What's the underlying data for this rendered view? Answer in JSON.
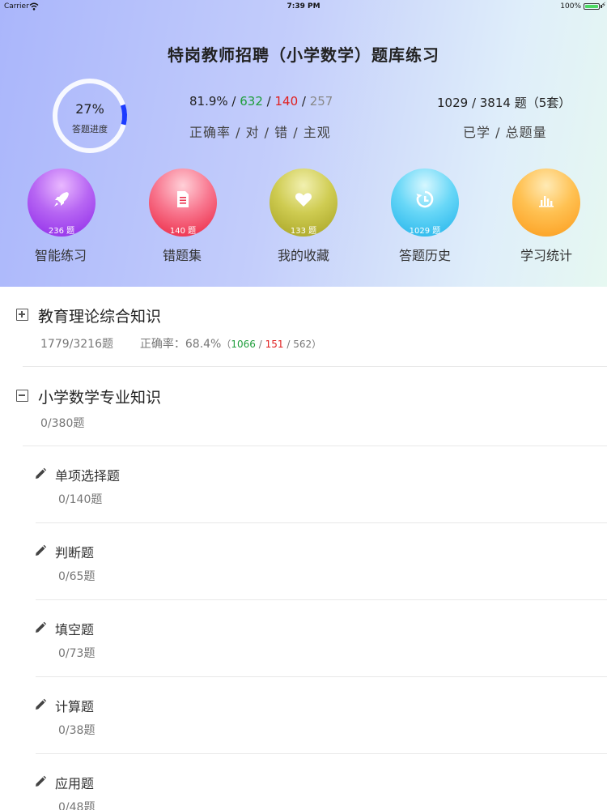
{
  "statusbar": {
    "carrier": "Carrier",
    "time": "7:39 PM",
    "battery": "100%"
  },
  "title": "特岗教师招聘（小学数学）题库练习",
  "progress": {
    "percent_text": "27%",
    "label": "答题进度",
    "value": 0.27
  },
  "stats": {
    "accuracy": "81.9%",
    "correct": "632",
    "wrong": "140",
    "subjective": "257",
    "sep": " / ",
    "label1": "正确率 / 对 / 错 / 主观",
    "learned_total": "1029 / 3814 题（5套）",
    "label2": "已学 / 总题量"
  },
  "buttons": [
    {
      "label": "智能练习",
      "count": "236 题",
      "icon": "rocket-icon"
    },
    {
      "label": "错题集",
      "count": "140 题",
      "icon": "document-icon"
    },
    {
      "label": "我的收藏",
      "count": "133 题",
      "icon": "heart-icon"
    },
    {
      "label": "答题历史",
      "count": "1029 题",
      "icon": "history-icon"
    },
    {
      "label": "学习统计",
      "count": "",
      "icon": "bar-chart-icon"
    }
  ],
  "sections": [
    {
      "title": "教育理论综合知识",
      "count": "1779/3216题",
      "accuracy_label": "正确率：68.4%",
      "open": "（",
      "correct": "1066",
      "wrong": "151",
      "subjective": "562",
      "close": "）",
      "sep": " / "
    },
    {
      "title": "小学数学专业知识",
      "count": "0/380题"
    }
  ],
  "subitems": [
    {
      "title": "单项选择题",
      "count": "0/140题"
    },
    {
      "title": "判断题",
      "count": "0/65题"
    },
    {
      "title": "填空题",
      "count": "0/73题"
    },
    {
      "title": "计算题",
      "count": "0/38题"
    },
    {
      "title": "应用题",
      "count": "0/48题"
    }
  ],
  "colors": {
    "correct": "#1f9e3c",
    "wrong": "#e02020",
    "progress_ring": "#1b3bff"
  }
}
